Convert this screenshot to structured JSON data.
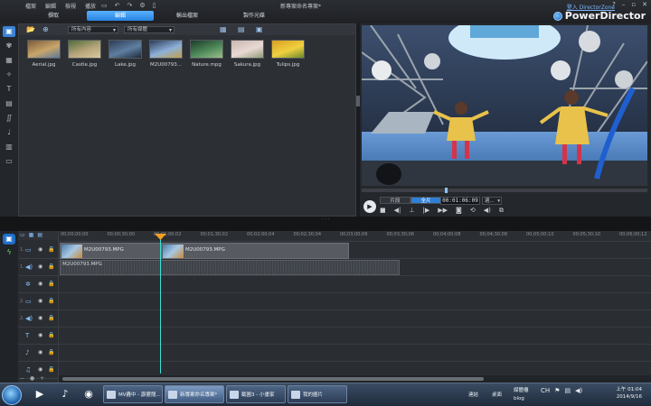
{
  "menu": [
    "檔案",
    "編輯",
    "檢視",
    "播放"
  ],
  "project_title": "新專案命名專案*",
  "directorzone_link": "登入 DirectorZone",
  "brand": "PowerDirector",
  "tabs": [
    {
      "label": "擷取",
      "active": false
    },
    {
      "label": "編輯",
      "active": true
    },
    {
      "label": "輸出檔案",
      "active": false
    },
    {
      "label": "製作光碟",
      "active": false
    }
  ],
  "library": {
    "filter_type": "所有內容",
    "filter_group": "所有媒體",
    "items": [
      {
        "caption": "Aerial.jpg",
        "colors": [
          "#7a5a3a",
          "#c9a56a",
          "#5b7a9a"
        ]
      },
      {
        "caption": "Castle.jpg",
        "colors": [
          "#4e6b3a",
          "#b7a57a",
          "#d9c9a0"
        ]
      },
      {
        "caption": "Lake.jpg",
        "colors": [
          "#2b3b55",
          "#5f7fa0",
          "#1f2a3a"
        ]
      },
      {
        "caption": "M2U00793...",
        "colors": [
          "#2a3a5a",
          "#8fb0d8",
          "#c2a04a"
        ]
      },
      {
        "caption": "Nature.mpg",
        "colors": [
          "#1d3a2a",
          "#4f8a5a",
          "#9ac08a"
        ]
      },
      {
        "caption": "Sakura.jpg",
        "colors": [
          "#c9b6b0",
          "#e9d9d4",
          "#8f9a7a"
        ]
      },
      {
        "caption": "Tulips.jpg",
        "colors": [
          "#d8a020",
          "#f0d040",
          "#6a8a2a"
        ]
      }
    ]
  },
  "preview": {
    "mode_clip": "片段",
    "mode_movie": "全片",
    "timecode": "00:01:06:09",
    "speed": "適..."
  },
  "timeline": {
    "ruler_ticks": [
      "00;00;00;00",
      "00;00;30;00",
      "00;01;00;02",
      "00;01;30;02",
      "00;02;00;04",
      "00;02;30;04",
      "00;03;00;06",
      "00;03;30;06",
      "00;04;00;08",
      "00;04;30;08",
      "00;05;00;10",
      "00;05;30;10",
      "00;06;00;12"
    ],
    "tracks": [
      {
        "num": "1.",
        "icon": "▭",
        "name": "video-track-1"
      },
      {
        "num": "1.",
        "icon": "◀)",
        "name": "audio-track-1"
      },
      {
        "num": "",
        "icon": "✲",
        "name": "effect-track"
      },
      {
        "num": "2.",
        "icon": "▭",
        "name": "video-track-2"
      },
      {
        "num": "2.",
        "icon": "◀)",
        "name": "audio-track-2"
      },
      {
        "num": "",
        "icon": "T",
        "name": "title-track"
      },
      {
        "num": "",
        "icon": "♪",
        "name": "voice-track"
      },
      {
        "num": "",
        "icon": "♫",
        "name": "music-track"
      }
    ],
    "clip_video_1": "M2U00793.MPG",
    "clip_video_2": "M2U00793.MPG",
    "clip_audio": "M2U00793.MPG"
  },
  "taskbar": {
    "windows": [
      {
        "label": "MV轟中 - 霹靂龍...",
        "active": false
      },
      {
        "label": "新專案命名專案*",
        "active": true
      },
      {
        "label": "截圖3 - 小畫家",
        "active": false
      },
      {
        "label": "我的圖片",
        "active": false
      }
    ],
    "tray_label_1": "連結",
    "tray_label_2": "桌面",
    "tray_label_3": "媒體櫃",
    "tray_label_4": "blog",
    "ime": "CH",
    "clock_time": "上午 01:04",
    "clock_date": "2014/9/16"
  }
}
